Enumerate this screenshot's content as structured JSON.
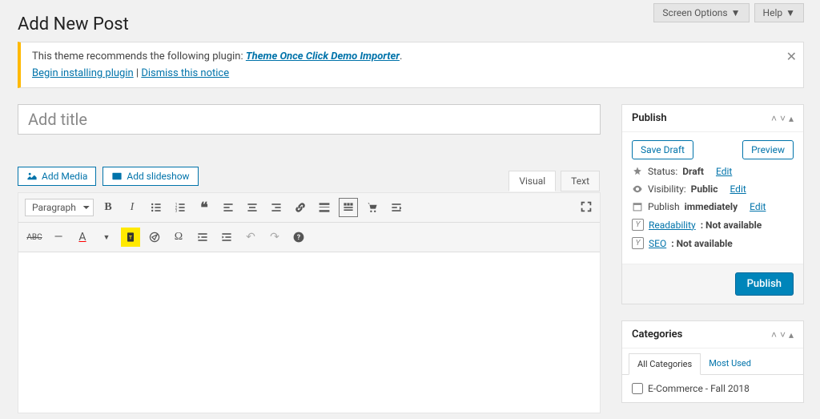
{
  "topButtons": {
    "screenOptions": "Screen Options",
    "help": "Help"
  },
  "pageTitle": "Add New Post",
  "notice": {
    "line1_pre": "This theme recommends the following plugin: ",
    "plugin": "Theme Once Click Demo Importer",
    "begin": "Begin installing plugin",
    "sep": " | ",
    "dismiss": "Dismiss this notice"
  },
  "titlePlaceholder": "Add title",
  "media": {
    "addMedia": "Add Media",
    "addSlideshow": "Add slideshow"
  },
  "editorTabs": {
    "visual": "Visual",
    "text": "Text"
  },
  "formatSelect": "Paragraph",
  "publishBox": {
    "title": "Publish",
    "saveDraft": "Save Draft",
    "preview": "Preview",
    "statusLabel": "Status: ",
    "statusValue": "Draft",
    "editLink": "Edit",
    "visibilityLabel": "Visibility: ",
    "visibilityValue": "Public",
    "publishLabel": "Publish ",
    "publishValue": "immediately",
    "readabilityLabel": "Readability",
    "readabilityValue": ": Not available",
    "seoLabel": "SEO",
    "seoValue": ": Not available",
    "publishButton": "Publish"
  },
  "categoriesBox": {
    "title": "Categories",
    "allTab": "All Categories",
    "mostUsedTab": "Most Used",
    "items": [
      "E-Commerce - Fall 2018"
    ]
  }
}
